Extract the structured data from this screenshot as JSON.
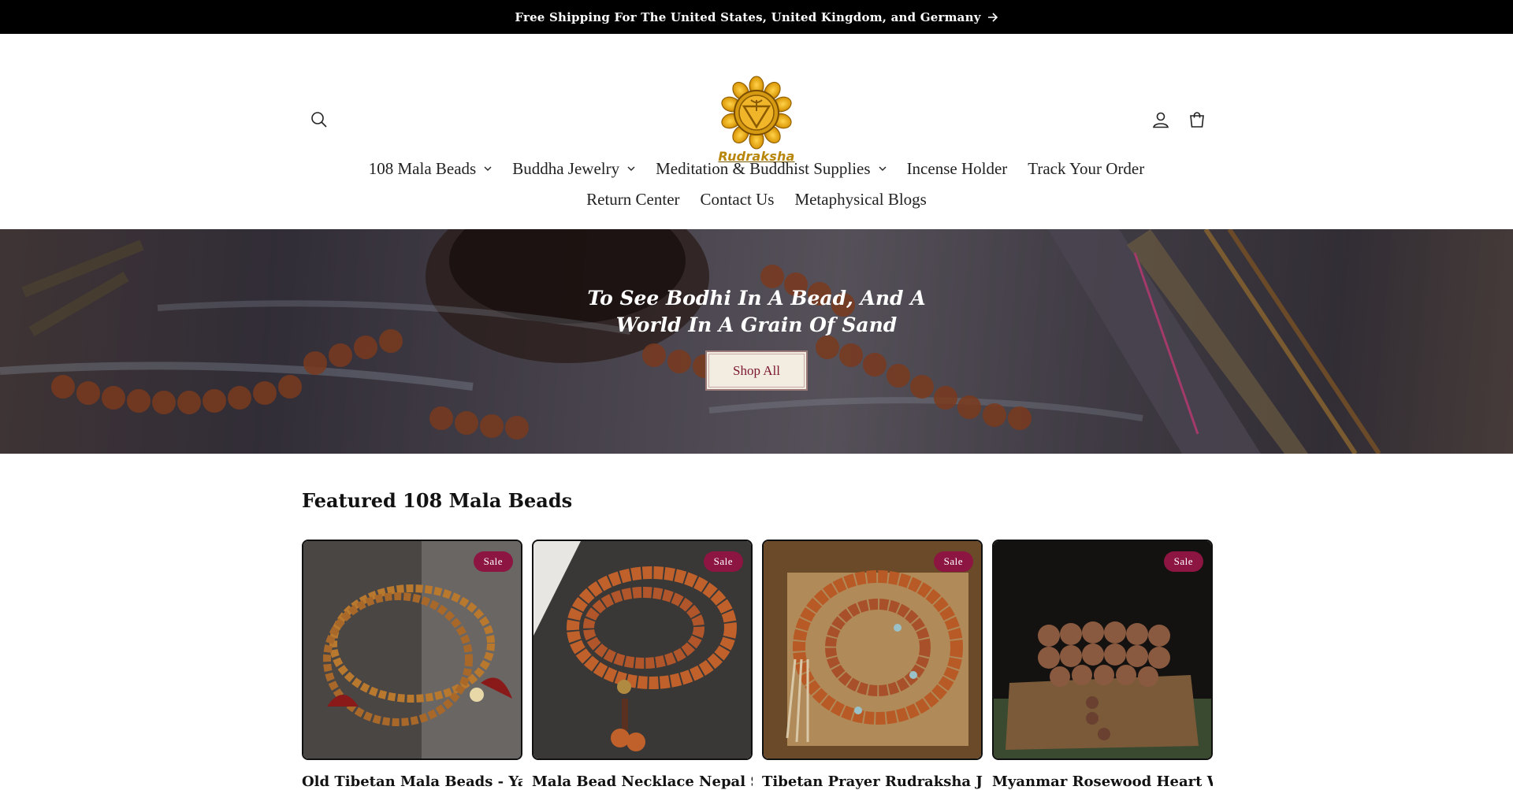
{
  "announcement": {
    "text": "Free Shipping For The United States, United Kingdom, and Germany",
    "icon": "arrow-right-icon"
  },
  "header": {
    "search_icon": "search-icon",
    "logo_text": "Rudraksha",
    "account_icon": "account-icon",
    "cart_icon": "cart-icon"
  },
  "nav": {
    "row1": [
      {
        "label": "108 Mala Beads",
        "has_dropdown": true
      },
      {
        "label": "Buddha Jewelry",
        "has_dropdown": true
      },
      {
        "label": "Meditation & Buddhist Supplies",
        "has_dropdown": true
      },
      {
        "label": "Incense Holder",
        "has_dropdown": false
      },
      {
        "label": "Track Your Order",
        "has_dropdown": false
      }
    ],
    "row2": [
      {
        "label": "Return Center"
      },
      {
        "label": "Contact Us"
      },
      {
        "label": "Metaphysical Blogs"
      }
    ]
  },
  "hero": {
    "heading": "To See Bodhi In A Bead, And A World In A Grain Of Sand",
    "button": "Shop All"
  },
  "featured": {
    "heading": "Featured 108 Mala Beads",
    "products": [
      {
        "title": "Old Tibetan Mala Beads - Yak",
        "badge": "Sale"
      },
      {
        "title": "Mala Bead Necklace Nepal Seed",
        "badge": "Sale"
      },
      {
        "title": "Tibetan Prayer Rudraksha Japa",
        "badge": "Sale"
      },
      {
        "title": "Myanmar Rosewood Heart Wood",
        "badge": "Sale"
      }
    ]
  },
  "colors": {
    "announcement_bg": "#000000",
    "sale_badge": "#8c1541",
    "button_bg": "#f3ece0",
    "button_text": "#7b1630"
  }
}
